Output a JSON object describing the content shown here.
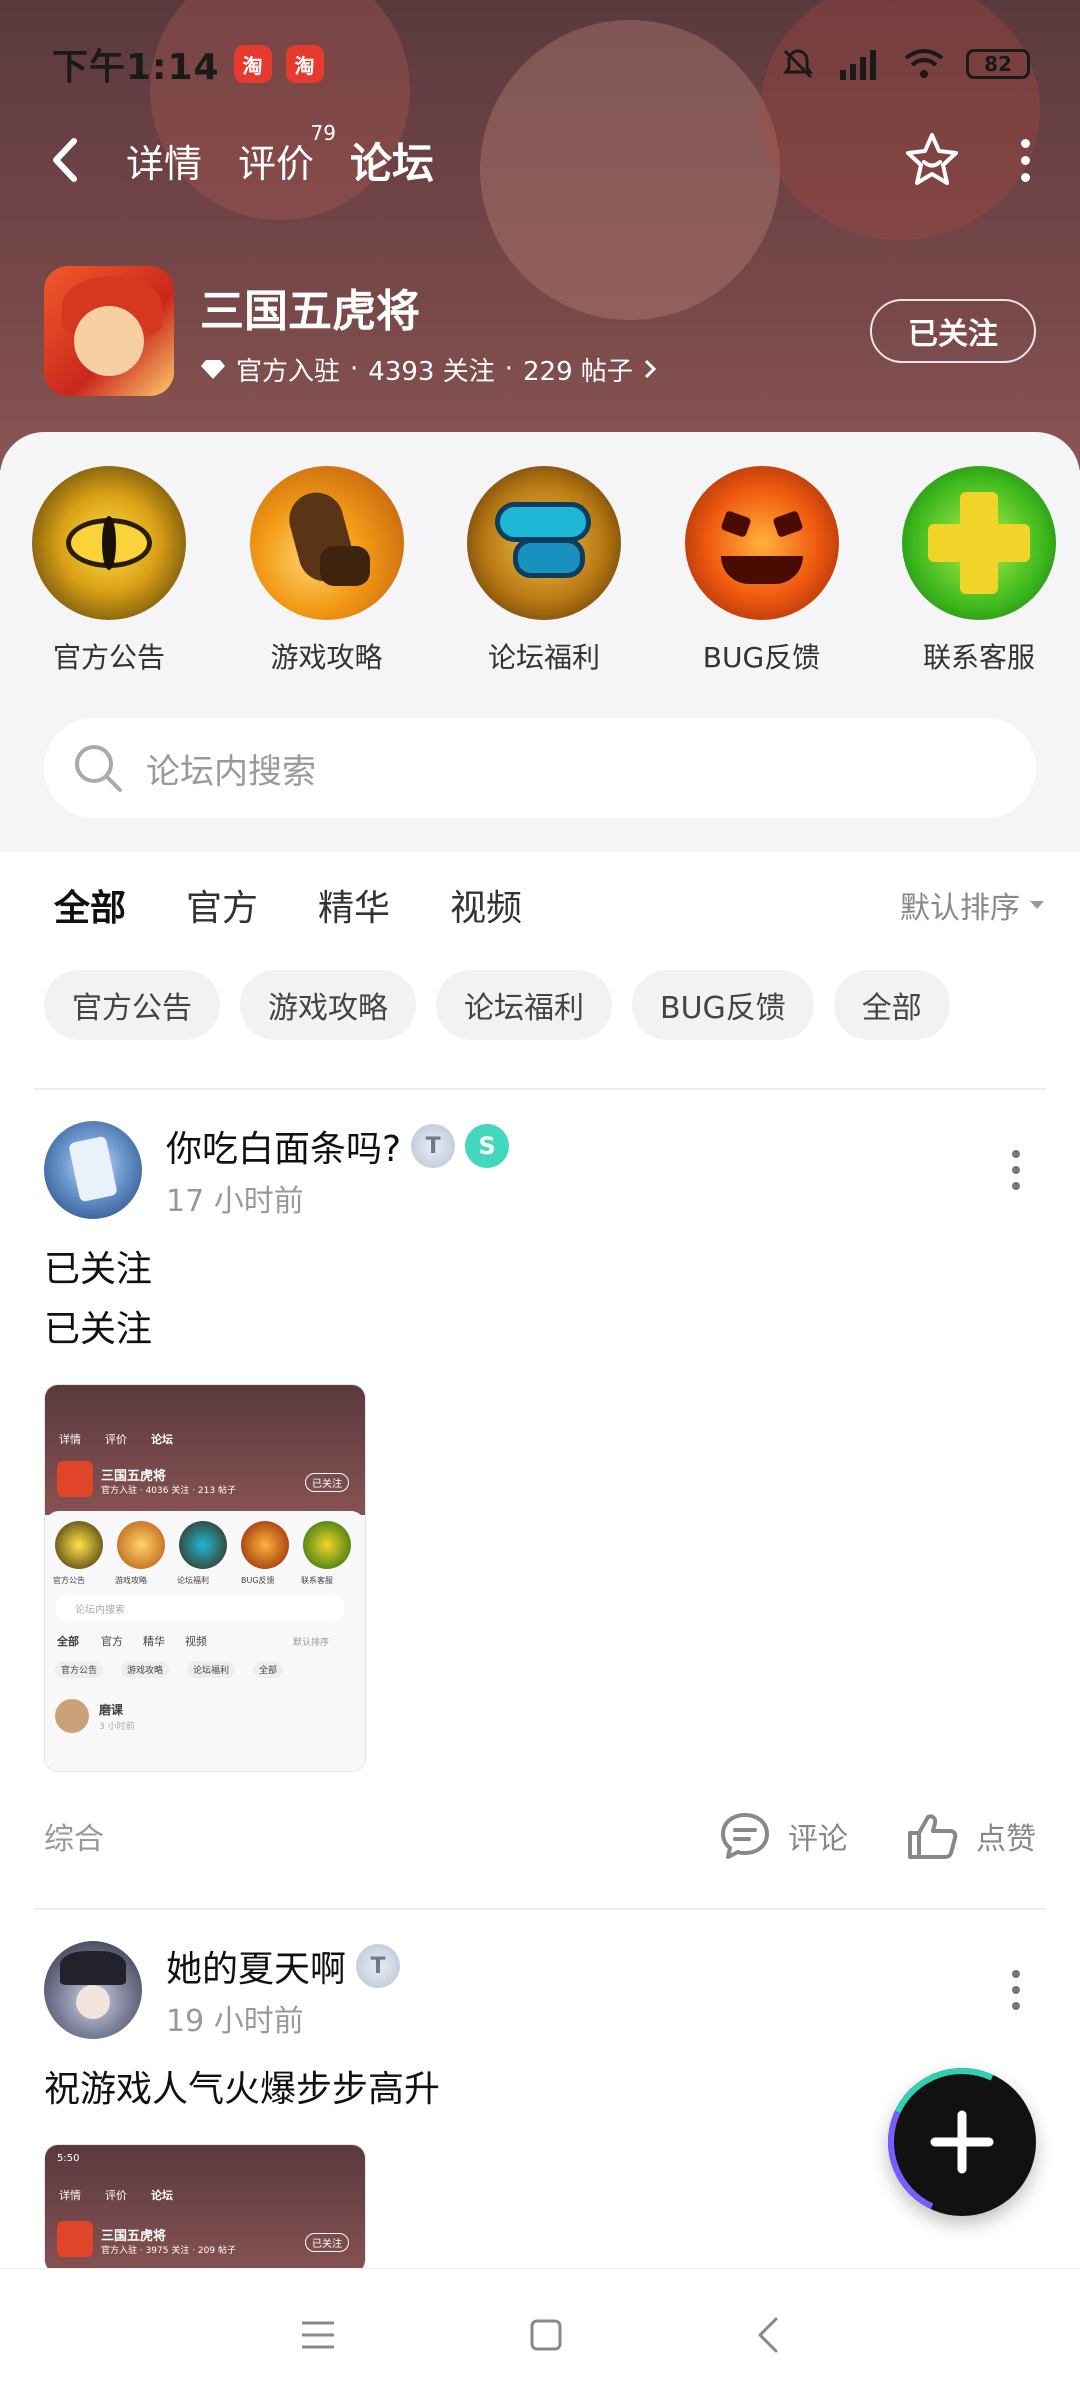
{
  "status_bar": {
    "time": "下午1:14",
    "app_badge_1": "淘",
    "app_badge_2": "淘",
    "battery": "82"
  },
  "nav": {
    "tabs": [
      {
        "label": "详情",
        "sup": ""
      },
      {
        "label": "评价",
        "sup": "79"
      },
      {
        "label": "论坛",
        "sup": ""
      }
    ],
    "active_tab": "论坛"
  },
  "game": {
    "title": "三国五虎将",
    "official": "官方入驻",
    "follows": "4393 关注",
    "posts": "229 帖子",
    "sep": "·",
    "follow_button": "已关注"
  },
  "categories": [
    {
      "label": "官方公告",
      "icon": "eye-icon"
    },
    {
      "label": "游戏攻略",
      "icon": "fist-icon"
    },
    {
      "label": "论坛福利",
      "icon": "gift-icon"
    },
    {
      "label": "BUG反馈",
      "icon": "pumpkin-icon"
    },
    {
      "label": "联系客服",
      "icon": "plus-cross-icon"
    }
  ],
  "search": {
    "placeholder": "论坛内搜索"
  },
  "filter_tabs": [
    "全部",
    "官方",
    "精华",
    "视频"
  ],
  "sort": "默认排序",
  "chips": [
    "官方公告",
    "游戏攻略",
    "论坛福利",
    "BUG反馈",
    "全部"
  ],
  "posts": [
    {
      "user": "你吃白面条吗?",
      "time": "17 小时前",
      "lines": [
        "已关注",
        "已关注"
      ],
      "category": "综合",
      "comment_label": "评论",
      "like_label": "点赞",
      "thumb": {
        "tabs": [
          "详情",
          "评价",
          "论坛"
        ],
        "title": "三国五虎将",
        "meta": "官方入驻 · 4036 关注 · 213 帖子",
        "follow": "已关注",
        "cats": [
          "官方公告",
          "游戏攻略",
          "论坛福利",
          "BUG反馈",
          "联系客服"
        ],
        "search": "论坛内搜索",
        "filters": [
          "全部",
          "官方",
          "精华",
          "视频"
        ],
        "sort": "默认排序",
        "chips": [
          "官方公告",
          "游戏攻略",
          "论坛福利",
          "全部"
        ],
        "user": "磨课",
        "time": "3 小时前"
      }
    },
    {
      "user": "她的夏天啊",
      "time": "19 小时前",
      "lines": [
        "祝游戏人气火爆步步高升"
      ],
      "thumb": {
        "time": "5:50",
        "tabs": [
          "详情",
          "评价",
          "论坛"
        ],
        "title": "三国五虎将",
        "meta": "官方入驻 · 3975 关注 · 209 帖子",
        "follow": "已关注"
      }
    }
  ],
  "colors": {
    "accent": "#2fd1b2",
    "header_bg": "#6d4346"
  }
}
